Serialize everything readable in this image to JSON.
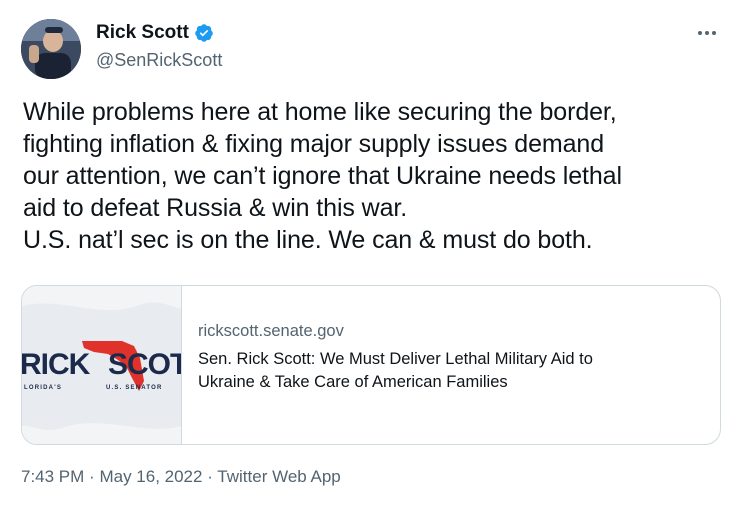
{
  "author": {
    "display_name": "Rick Scott",
    "handle": "@SenRickScott",
    "verified": true
  },
  "icons": {
    "verified": "verified-badge-icon",
    "more": "more-options-icon"
  },
  "tweet": {
    "text": "While problems here at home like securing the border,\nfighting inflation & fixing major supply issues demand\nour attention, we can’t ignore that Ukraine needs lethal\naid to defeat Russia & win this war.\nU.S. nat’l sec is on the line. We can & must do both."
  },
  "card": {
    "domain": "rickscott.senate.gov",
    "title": "Sen. Rick Scott: We Must Deliver Lethal Military Aid to\nUkraine & Take Care of American Families",
    "thumb_logo_text": "RICK SCOTT",
    "thumb_sub_left": "FLORIDA'S",
    "thumb_sub_right": "U.S. SENATOR"
  },
  "meta": {
    "time": "7:43 PM",
    "separator": "·",
    "date": "May 16, 2022",
    "source": "Twitter Web App"
  },
  "colors": {
    "verified_blue": "#1d9bf0",
    "secondary_text": "#536471",
    "border": "#cfd9de",
    "logo_red": "#e0322a",
    "logo_navy": "#1b2a4a"
  }
}
